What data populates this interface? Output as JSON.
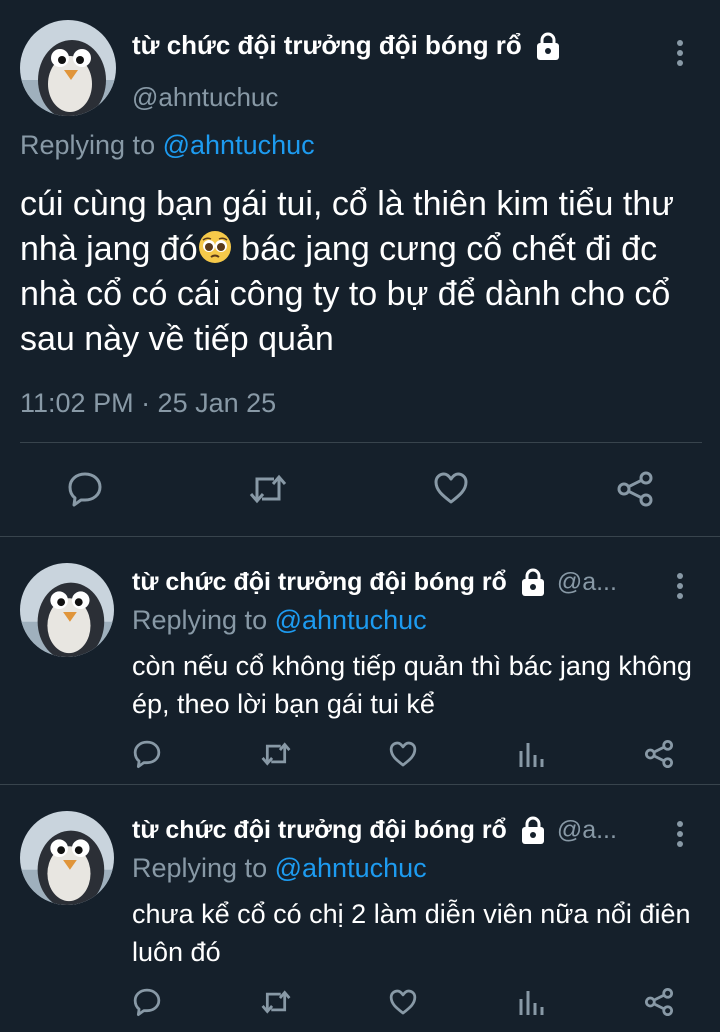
{
  "main_tweet": {
    "display_name": "từ chức đội trưởng đội bóng rổ",
    "handle": "@ahntuchuc",
    "replying_label": "Replying to",
    "replying_handle": "@ahntuchuc",
    "text_before_emoji": "cúi cùng bạn gái tui, cổ là thiên kim tiểu thư nhà jang đó",
    "emoji": "pleading-face-emoji",
    "text_after_emoji": " bác jang cưng cổ chết đi đc nhà cổ có cái công ty to bự để dành cho cổ sau này về tiếp quản",
    "timestamp": "11:02 PM · 25 Jan 25",
    "actions": [
      "reply-icon",
      "retweet-icon",
      "like-icon",
      "share-icon"
    ]
  },
  "replies": [
    {
      "display_name": "từ chức đội trưởng đội bóng rổ",
      "handle_truncated": "@a...",
      "replying_label": "Replying to",
      "replying_handle": "@ahntuchuc",
      "text": "còn nếu cổ không tiếp quản thì bác jang không ép, theo lời bạn gái tui kể",
      "actions": [
        "reply-icon",
        "retweet-icon",
        "like-icon",
        "analytics-icon",
        "share-icon"
      ]
    },
    {
      "display_name": "từ chức đội trưởng đội bóng rổ",
      "handle_truncated": "@a...",
      "replying_label": "Replying to",
      "replying_handle": "@ahntuchuc",
      "text": "chưa kể cổ có chị 2 làm diễn viên nữa nổi điên luôn đó",
      "actions": [
        "reply-icon",
        "retweet-icon",
        "like-icon",
        "analytics-icon",
        "share-icon"
      ]
    }
  ],
  "colors": {
    "background": "#15202b",
    "text": "#ffffff",
    "muted": "#8899a6",
    "link": "#1d9bf0",
    "divider": "#38444d"
  }
}
